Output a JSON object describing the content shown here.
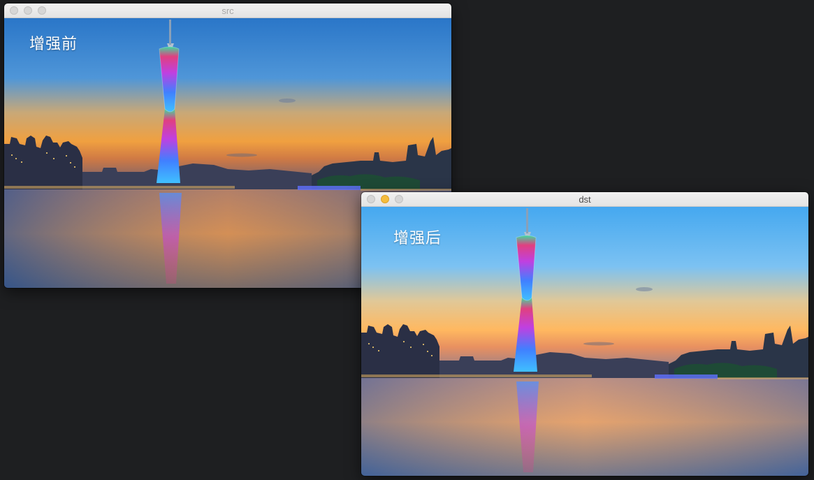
{
  "windows": [
    {
      "id": "src",
      "title": "src",
      "active": false,
      "overlay_label": "增强前",
      "controls": [
        "close-button",
        "minimize-button",
        "zoom-button"
      ]
    },
    {
      "id": "dst",
      "title": "dst",
      "active": true,
      "overlay_label": "增强后",
      "controls": [
        "close-button",
        "minimize-button",
        "zoom-button"
      ]
    }
  ],
  "colors": {
    "desktop_bg": "#1e1f21",
    "minimize_active": "#f5bd3d",
    "inactive_light": "#d6d6d6"
  }
}
